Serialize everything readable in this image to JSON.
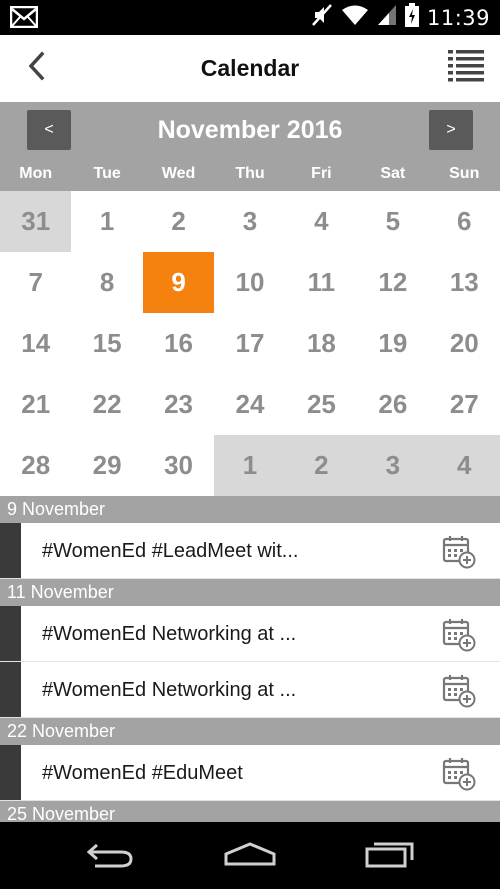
{
  "status_bar": {
    "time": "11:39",
    "icons": [
      "gmail-icon",
      "mute-icon",
      "wifi-icon",
      "signal-icon",
      "battery-icon"
    ]
  },
  "header": {
    "title": "Calendar",
    "back_icon": "chevron-left-icon",
    "menu_icon": "list-icon"
  },
  "calendar": {
    "month_title": "November 2016",
    "prev_label": "<",
    "next_label": ">",
    "weekdays": [
      "Mon",
      "Tue",
      "Wed",
      "Thu",
      "Fri",
      "Sat",
      "Sun"
    ],
    "days": [
      {
        "label": "31",
        "type": "other"
      },
      {
        "label": "1",
        "type": "current"
      },
      {
        "label": "2",
        "type": "current"
      },
      {
        "label": "3",
        "type": "current"
      },
      {
        "label": "4",
        "type": "current"
      },
      {
        "label": "5",
        "type": "current"
      },
      {
        "label": "6",
        "type": "current"
      },
      {
        "label": "7",
        "type": "current"
      },
      {
        "label": "8",
        "type": "current"
      },
      {
        "label": "9",
        "type": "today"
      },
      {
        "label": "10",
        "type": "current"
      },
      {
        "label": "11",
        "type": "current"
      },
      {
        "label": "12",
        "type": "current"
      },
      {
        "label": "13",
        "type": "current"
      },
      {
        "label": "14",
        "type": "current"
      },
      {
        "label": "15",
        "type": "current"
      },
      {
        "label": "16",
        "type": "current"
      },
      {
        "label": "17",
        "type": "current"
      },
      {
        "label": "18",
        "type": "current"
      },
      {
        "label": "19",
        "type": "current"
      },
      {
        "label": "20",
        "type": "current"
      },
      {
        "label": "21",
        "type": "current"
      },
      {
        "label": "22",
        "type": "current"
      },
      {
        "label": "23",
        "type": "current"
      },
      {
        "label": "24",
        "type": "current"
      },
      {
        "label": "25",
        "type": "current"
      },
      {
        "label": "26",
        "type": "current"
      },
      {
        "label": "27",
        "type": "current"
      },
      {
        "label": "28",
        "type": "current"
      },
      {
        "label": "29",
        "type": "current"
      },
      {
        "label": "30",
        "type": "current"
      },
      {
        "label": "1",
        "type": "other"
      },
      {
        "label": "2",
        "type": "other"
      },
      {
        "label": "3",
        "type": "other"
      },
      {
        "label": "4",
        "type": "other"
      }
    ]
  },
  "events": [
    {
      "date": "9 November",
      "items": [
        "#WomenEd #LeadMeet wit..."
      ]
    },
    {
      "date": "11 November",
      "items": [
        "#WomenEd Networking at ...",
        "#WomenEd Networking at ..."
      ]
    },
    {
      "date": "22 November",
      "items": [
        "#WomenEd #EduMeet"
      ]
    },
    {
      "date": "25 November",
      "items": []
    }
  ],
  "colors": {
    "accent_today": "#f5820f",
    "bar_gray": "#a3a3a3",
    "nav_button": "#5a5a5a",
    "other_month": "#d8d8d8",
    "day_text": "#8d8d8d",
    "event_marker": "#3a3a3a"
  },
  "nav_bar": {
    "icons": [
      "back-icon",
      "home-icon",
      "recents-icon"
    ]
  }
}
